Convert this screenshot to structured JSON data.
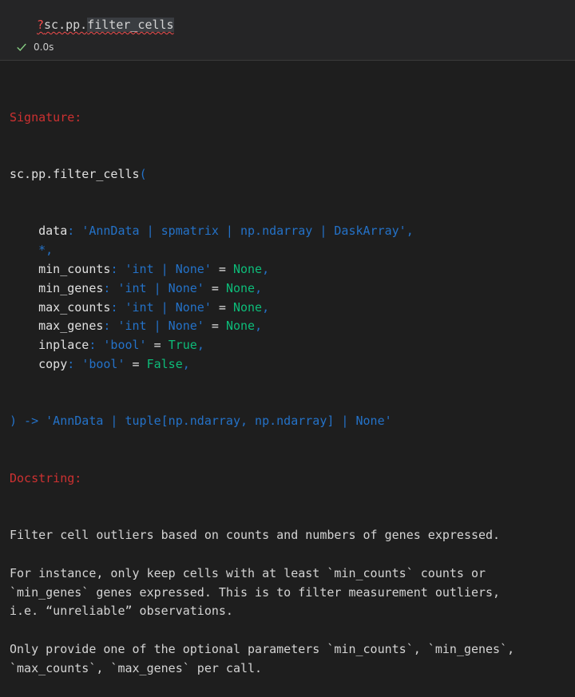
{
  "cell": {
    "code_prefix": "?",
    "code_module": "sc.pp.",
    "code_func": "filter_cells",
    "status_time": "0.0s"
  },
  "output": {
    "signature_header": "Signature:",
    "sig_head_name": "sc.pp.filter_cells",
    "sig_head_paren": "(",
    "params": [
      {
        "name": "data",
        "sep": ": ",
        "type": "'AnnData | spmatrix | np.ndarray | DaskArray'",
        "eq": "",
        "default": "",
        "comma": ","
      },
      {
        "name": "",
        "sep": "",
        "type": "*",
        "eq": "",
        "default": "",
        "comma": ","
      },
      {
        "name": "min_counts",
        "sep": ": ",
        "type": "'int | None'",
        "eq": " = ",
        "default": "None",
        "comma": ","
      },
      {
        "name": "min_genes",
        "sep": ": ",
        "type": "'int | None'",
        "eq": " = ",
        "default": "None",
        "comma": ","
      },
      {
        "name": "max_counts",
        "sep": ": ",
        "type": "'int | None'",
        "eq": " = ",
        "default": "None",
        "comma": ","
      },
      {
        "name": "max_genes",
        "sep": ": ",
        "type": "'int | None'",
        "eq": " = ",
        "default": "None",
        "comma": ","
      },
      {
        "name": "inplace",
        "sep": ": ",
        "type": "'bool'",
        "eq": " = ",
        "default": "True",
        "comma": ","
      },
      {
        "name": "copy",
        "sep": ": ",
        "type": "'bool'",
        "eq": " = ",
        "default": "False",
        "comma": ","
      }
    ],
    "sig_close": ") -> 'AnnData | tuple[np.ndarray, np.ndarray] | None'",
    "docstring_header": "Docstring:",
    "doc_lines": [
      "Filter cell outliers based on counts and numbers of genes expressed.",
      "",
      "For instance, only keep cells with at least `min_counts` counts or",
      "`min_genes` genes expressed. This is to filter measurement outliers,",
      "i.e. “unreliable” observations.",
      "",
      "Only provide one of the optional parameters `min_counts`, `min_genes`,",
      "`max_counts`, `max_genes` per call."
    ]
  }
}
